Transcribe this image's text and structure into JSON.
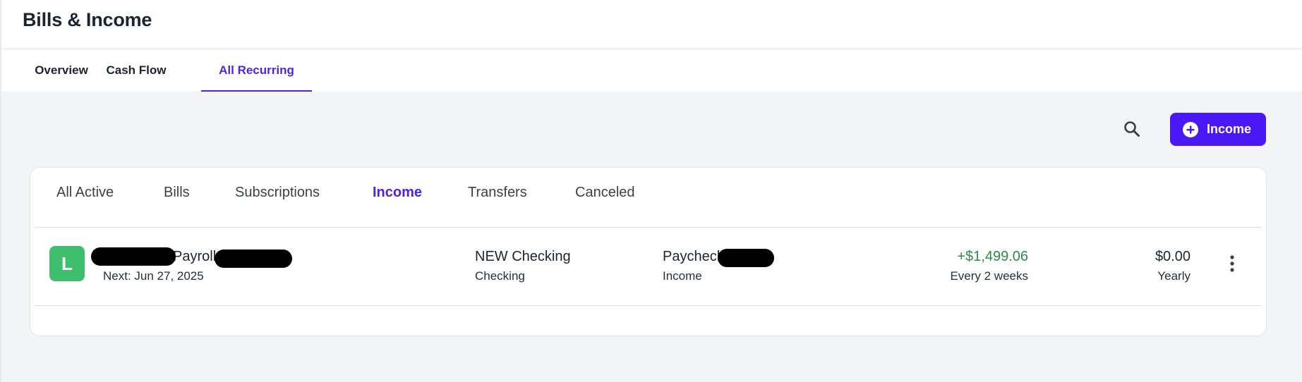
{
  "header": {
    "title": "Bills & Income"
  },
  "nav_tabs": [
    {
      "label": "Overview"
    },
    {
      "label": "Cash Flow"
    },
    {
      "label": "All Recurring",
      "active": true
    }
  ],
  "toolbar": {
    "search_icon": "search-icon",
    "add_button_label": "Income",
    "add_button_icon": "plus-circle-icon"
  },
  "filter_tabs": [
    {
      "label": "All Active"
    },
    {
      "label": "Bills"
    },
    {
      "label": "Subscriptions"
    },
    {
      "label": "Income",
      "active": true
    },
    {
      "label": "Transfers"
    },
    {
      "label": "Canceled"
    }
  ],
  "rows": [
    {
      "avatar_letter": "L",
      "name": "Payroll",
      "next": "Next: Jun 27, 2025",
      "account": "NEW Checking",
      "account_type": "Checking",
      "category": "Paycheck",
      "category_type": "Income",
      "amount": "+$1,499.06",
      "frequency": "Every 2 weeks",
      "yearly_amount": "$0.00",
      "yearly_label": "Yearly"
    }
  ],
  "colors": {
    "accent": "#4a24e8",
    "button": "#4a17f5",
    "positive": "#2f8a47",
    "avatar": "#3dbf6e",
    "background": "#f3f4f6"
  }
}
